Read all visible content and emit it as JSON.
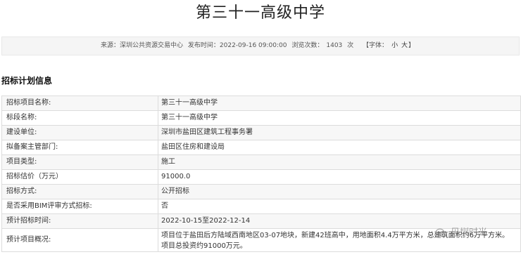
{
  "page": {
    "title": "第三十一高级中学"
  },
  "meta": {
    "source": "来源：深圳公共资源交易中心",
    "publish_time": "发布时间：2022-09-16 09:00:00",
    "views_label": "浏览次数：",
    "views_count": "1403",
    "views_unit": "次",
    "font_label": "【字体：",
    "font_small": "小",
    "font_large": "大",
    "font_close": "】"
  },
  "section": {
    "title": "招标计划信息"
  },
  "rows": [
    {
      "label": "招标项目名称:",
      "value": "第三十一高级中学"
    },
    {
      "label": "标段名称:",
      "value": "第三十一高级中学"
    },
    {
      "label": "建设单位:",
      "value": "深圳市盐田区建筑工程事务署"
    },
    {
      "label": "拟备案主管部门:",
      "value": "盐田区住房和建设局"
    },
    {
      "label": "项目类型:",
      "value": "施工"
    },
    {
      "label": "招标估价（万元）",
      "value": "91000.0"
    },
    {
      "label": "招标方式:",
      "value": "公开招标"
    },
    {
      "label": "是否采用BIM评审方式招标:",
      "value": "否"
    },
    {
      "label": "预计招标时间:",
      "value": "2022-10-15至2022-12-14"
    },
    {
      "label": "预计项目概况:",
      "value": "项目位于盐田后方陆域西南地区03-07地块，新建42班高中，用地面积4.4万平方米，总建筑面积约6万平方米。项目总投资约91000万元。"
    }
  ],
  "watermark": {
    "text": "贝圳时光",
    "icon": "wechat-icon"
  }
}
